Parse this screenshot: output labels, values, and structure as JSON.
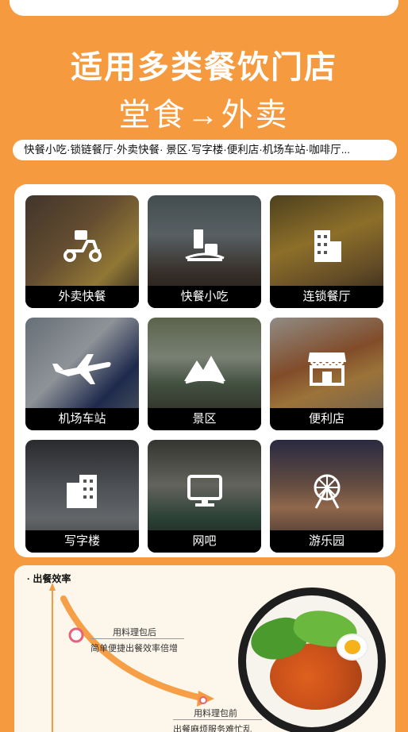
{
  "headline": "适用多类餐饮门店",
  "subline": "堂食→外卖",
  "categories_text": "快餐小吃·锁链餐厅·外卖快餐· 景区·写字楼·便利店·机场车站·咖啡厅...",
  "tiles": [
    {
      "label": "外卖快餐",
      "icon": "delivery-scooter-icon"
    },
    {
      "label": "快餐小吃",
      "icon": "fast-food-icon"
    },
    {
      "label": "连锁餐厅",
      "icon": "buildings-icon"
    },
    {
      "label": "机场车站",
      "icon": "airplane-icon"
    },
    {
      "label": "景区",
      "icon": "mountain-icon"
    },
    {
      "label": "便利店",
      "icon": "storefront-icon"
    },
    {
      "label": "写字楼",
      "icon": "office-building-icon"
    },
    {
      "label": "网吧",
      "icon": "computer-monitor-icon"
    },
    {
      "label": "游乐园",
      "icon": "ferris-wheel-icon"
    }
  ],
  "efficiency": {
    "title": "· 出餐效率",
    "after_label": "用料理包后",
    "after_desc": "简单便捷出餐效率倍增",
    "before_label": "用料理包前",
    "before_desc": "出餐麻烦服务难忙乱"
  },
  "colors": {
    "accent": "#f59a3e",
    "panel": "#ffffff",
    "caption_bg": "#000000"
  }
}
